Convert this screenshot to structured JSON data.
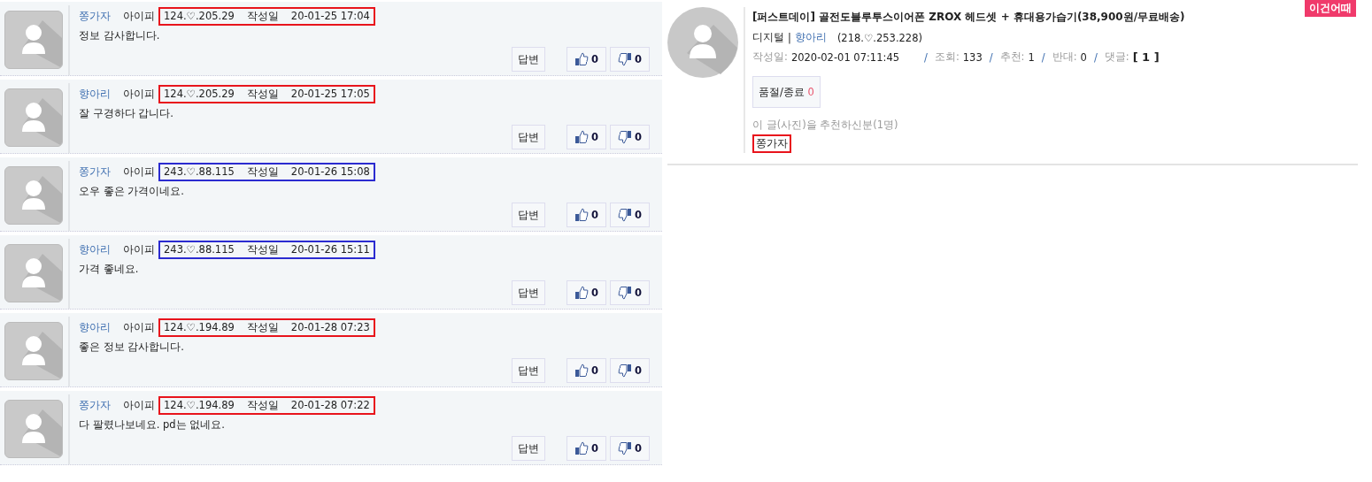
{
  "comments": [
    {
      "author": "쫑가자",
      "ip_label": "아이피",
      "ip": "124.♡.205.29",
      "date_label": "작성일",
      "date": "20-01-25 17:04",
      "text": "정보 감사합니다.",
      "reply": "답변",
      "likes": "0",
      "dislikes": "0",
      "color": "#e8141c"
    },
    {
      "author": "향아리",
      "ip_label": "아이피",
      "ip": "124.♡.205.29",
      "date_label": "작성일",
      "date": "20-01-25 17:05",
      "text": "잘 구경하다 갑니다.",
      "reply": "답변",
      "likes": "0",
      "dislikes": "0",
      "color": "#e8141c"
    },
    {
      "author": "쫑가자",
      "ip_label": "아이피",
      "ip": "243.♡.88.115",
      "date_label": "작성일",
      "date": "20-01-26 15:08",
      "text": "오우 좋은 가격이네요.",
      "reply": "답변",
      "likes": "0",
      "dislikes": "0",
      "color": "#2b2bd0"
    },
    {
      "author": "향아리",
      "ip_label": "아이피",
      "ip": "243.♡.88.115",
      "date_label": "작성일",
      "date": "20-01-26 15:11",
      "text": "가격 좋네요.",
      "reply": "답변",
      "likes": "0",
      "dislikes": "0",
      "color": "#2b2bd0"
    },
    {
      "author": "향아리",
      "ip_label": "아이피",
      "ip": "124.♡.194.89",
      "date_label": "작성일",
      "date": "20-01-28 07:23",
      "text": "좋은 정보 감사합니다.",
      "reply": "답변",
      "likes": "0",
      "dislikes": "0",
      "color": "#e8141c"
    },
    {
      "author": "쫑가자",
      "ip_label": "아이피",
      "ip": "124.♡.194.89",
      "date_label": "작성일",
      "date": "20-01-28 07:22",
      "text": "다 팔렸나보네요. pd는 없네요.",
      "reply": "답변",
      "likes": "0",
      "dislikes": "0",
      "color": "#e8141c"
    }
  ],
  "post": {
    "badge": "이건어때",
    "title": "[퍼스트데이] 골전도블루투스이어폰 ZROX 헤드셋 + 휴대용가습기(38,900원/무료배송)",
    "category": "디지털",
    "separator": "|",
    "author": "향아리",
    "ip": "(218.♡.253.228)",
    "meta": [
      {
        "label": "작성일:",
        "value": "2020-02-01 07:11:45"
      },
      {
        "separator": "/",
        "label": "조회:",
        "value": "133"
      },
      {
        "separator": "/",
        "label": "추천:",
        "value": "1"
      },
      {
        "separator": "/",
        "label": "반대:",
        "value": "0"
      },
      {
        "separator": "/",
        "label": "댓글:",
        "value": "[ 1 ]"
      }
    ],
    "soldout_label": "품절/종료",
    "soldout_count": "0",
    "recommend_label": "이 글(사진)을 추천하신분(1명)",
    "recommenders": [
      {
        "name": "쫑가자",
        "color": "#e8141c"
      }
    ]
  }
}
